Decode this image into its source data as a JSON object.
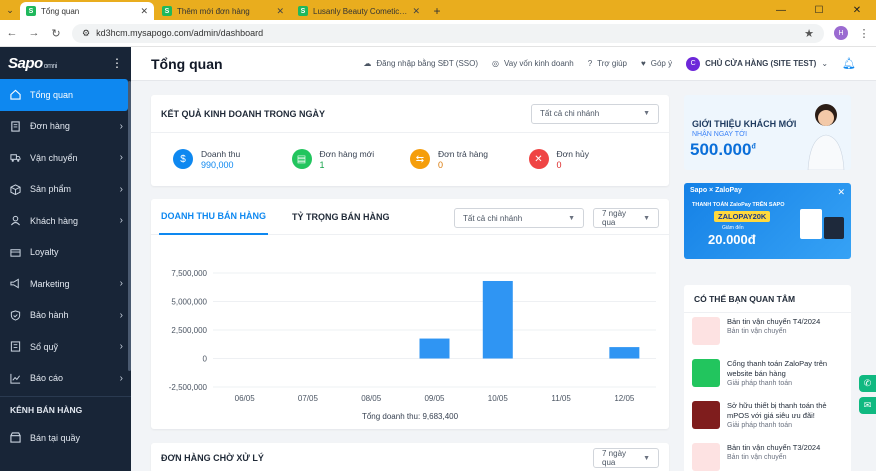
{
  "browser": {
    "tabs": [
      {
        "title": "Tổng quan",
        "active": true
      },
      {
        "title": "Thêm mới đơn hàng",
        "active": false
      },
      {
        "title": "Lusanly Beauty Cometics - Tran",
        "active": false
      }
    ],
    "url": "kd3hcm.mysapogo.com/admin/dashboard",
    "profile_initial": "H"
  },
  "sidebar": {
    "brand": "Sapo",
    "brand_suffix": "omni",
    "items": [
      {
        "label": "Tổng quan",
        "icon": "home-icon",
        "active": true,
        "chevron": false
      },
      {
        "label": "Đơn hàng",
        "icon": "order-icon",
        "active": false,
        "chevron": true
      },
      {
        "label": "Vận chuyển",
        "icon": "truck-icon",
        "active": false,
        "chevron": true
      },
      {
        "label": "Sản phẩm",
        "icon": "box-icon",
        "active": false,
        "chevron": true
      },
      {
        "label": "Khách hàng",
        "icon": "user-icon",
        "active": false,
        "chevron": true
      },
      {
        "label": "Loyalty",
        "icon": "loyalty-icon",
        "active": false,
        "chevron": false
      },
      {
        "label": "Marketing",
        "icon": "marketing-icon",
        "active": false,
        "chevron": true
      },
      {
        "label": "Bảo hành",
        "icon": "shield-icon",
        "active": false,
        "chevron": true
      },
      {
        "label": "Sổ quỹ",
        "icon": "cashbook-icon",
        "active": false,
        "chevron": true
      },
      {
        "label": "Báo cáo",
        "icon": "chart-icon",
        "active": false,
        "chevron": true
      }
    ],
    "section_label": "KÊNH BÁN HÀNG",
    "channel_item": "Bán tại quầy"
  },
  "header": {
    "title": "Tổng quan",
    "sso": "Đăng nhập bằng SĐT (SSO)",
    "loan": "Vay vốn kinh doanh",
    "help": "Trợ giúp",
    "feedback": "Góp ý",
    "avatar_initial": "C",
    "store": "CHỦ CỬA HÀNG (SITE TEST)"
  },
  "results": {
    "title": "KẾT QUẢ KINH DOANH TRONG NGÀY",
    "branch_select": "Tất cả chi nhánh",
    "kpis": [
      {
        "label": "Doanh thu",
        "value": "990,000",
        "color": "#0e88f0",
        "value_color": "#0e88f0"
      },
      {
        "label": "Đơn hàng mới",
        "value": "1",
        "color": "#22c55e",
        "value_color": "#16a34a"
      },
      {
        "label": "Đơn trả hàng",
        "value": "0",
        "color": "#f59e0b",
        "value_color": "#d97706"
      },
      {
        "label": "Đơn hủy",
        "value": "0",
        "color": "#ef4444",
        "value_color": "#dc2626"
      }
    ]
  },
  "revenue": {
    "tab_revenue": "DOANH THU BÁN HÀNG",
    "tab_share": "TỶ TRỌNG BÁN HÀNG",
    "branch_select": "Tất cả chi nhánh",
    "period_select": "7 ngày qua",
    "total_label": "Tổng doanh thu: 9,683,400"
  },
  "chart_data": {
    "type": "bar",
    "categories": [
      "06/05",
      "07/05",
      "08/05",
      "09/05",
      "10/05",
      "11/05",
      "12/05"
    ],
    "values": [
      0,
      0,
      0,
      1750000,
      6800000,
      0,
      1000000
    ],
    "y_ticks": [
      "7,500,000",
      "5,000,000",
      "2,500,000",
      "0",
      "-2,500,000"
    ],
    "y_tick_values": [
      7500000,
      5000000,
      2500000,
      0,
      -2500000
    ],
    "ylim": [
      -2500000,
      7500000
    ],
    "bar_color": "#2f95f3",
    "grid": true,
    "title": "",
    "xlabel": "",
    "ylabel": ""
  },
  "pending": {
    "title": "ĐƠN HÀNG CHỜ XỬ LÝ",
    "period_select": "7 ngày qua"
  },
  "ads": {
    "intro_title": "GIỚI THIỆU KHÁCH MỚI",
    "intro_sub": "NHẬN NGAY TỚI",
    "intro_amount": "500.000",
    "intro_currency": "đ",
    "zalo_brand": "Sapo × ZaloPay",
    "zalo_line1": "THANH TOÁN ZaloPay TRÊN SAPO",
    "zalo_code": "ZALOPAY20K",
    "zalo_line2": "Giảm đến",
    "zalo_amount": "20.000đ"
  },
  "news": {
    "title": "CÓ THỂ BẠN QUAN TÂM",
    "items": [
      {
        "title": "Bản tin vận chuyển T4/2024",
        "sub": "Bản tin vận chuyển",
        "thumb": "#fde2e2"
      },
      {
        "title": "Cổng thanh toán ZaloPay trên website bán hàng",
        "sub": "Giải pháp thanh toán",
        "thumb": "#22c55e"
      },
      {
        "title": "Sở hữu thiết bị thanh toán thẻ mPOS với giá siêu ưu đãi!",
        "sub": "Giải pháp thanh toán",
        "thumb": "#7f1d1d"
      },
      {
        "title": "Bản tin vận chuyển T3/2024",
        "sub": "Bản tin vận chuyển",
        "thumb": "#fde2e2"
      }
    ]
  }
}
